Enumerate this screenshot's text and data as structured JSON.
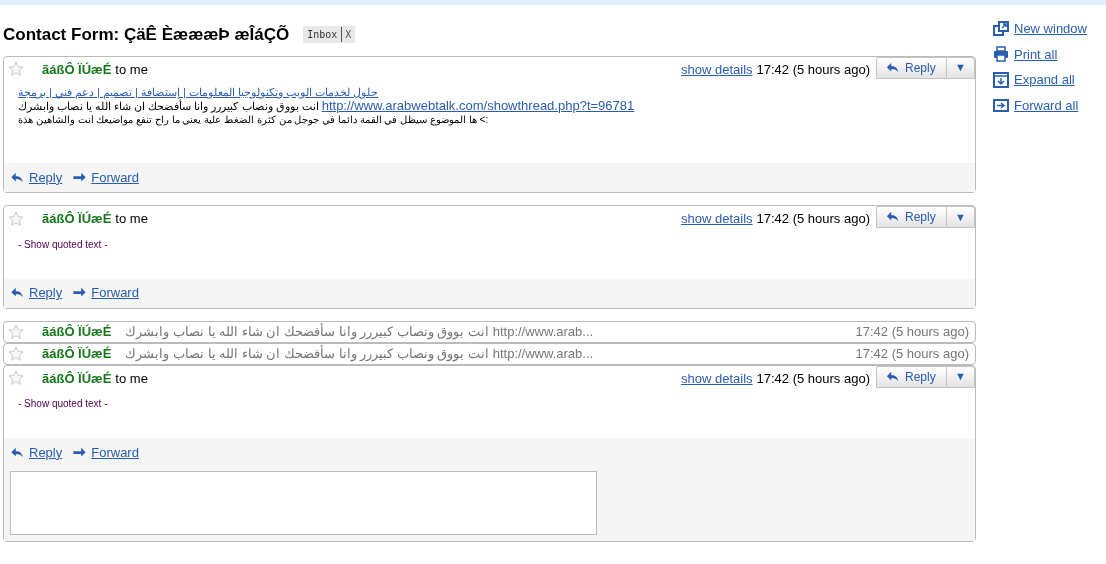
{
  "subject": "Contact Form: ÇäÊ ÈæææÞ æÎáÇÕ",
  "labels": [
    {
      "text": "Inbox",
      "remove": "X"
    }
  ],
  "messages": [
    {
      "kind": "expanded",
      "starred": false,
      "sender": "ãáßÔ ÏÚæÉ",
      "recipient": "to me",
      "details_link": "show details",
      "time": "17:42 (5 hours ago)",
      "reply_button": "Reply",
      "menu_button": "▼",
      "body": [
        {
          "kind": "link",
          "text": "حلول لخدمات الويب وتكنولوجيا المعلومات | إستضافة | تصميم | دعم فني | برمجة"
        },
        {
          "kind": "text_link",
          "text": "انت بووق ونصاب كبيررر وانا سأفضحك ان شاء الله يا نصاب وابشرك ",
          "link": "http://www.arabwebtalk.com/showthread.php?t=96781"
        },
        {
          "kind": "text",
          "text": "ها الموضوع سيظل في القمة دائما في جوجل من كثرة الضغط علية يعني ما راح تنفع مواضيعك انت والشاهين هذة <:"
        }
      ],
      "actions": [
        "Reply",
        "Forward"
      ]
    },
    {
      "kind": "expanded",
      "starred": false,
      "sender": "ãáßÔ ÏÚæÉ",
      "recipient": "to me",
      "details_link": "show details",
      "time": "17:42 (5 hours ago)",
      "reply_button": "Reply",
      "menu_button": "▼",
      "quoted": "- Show quoted text -",
      "actions": [
        "Reply",
        "Forward"
      ]
    },
    {
      "kind": "collapsed",
      "starred": false,
      "sender": "ãáßÔ ÏÚæÉ",
      "snippet": "انت بووق ونصاب كبيررر وانا سأفضحك ان شاء الله يا نصاب وابشرك http://www.arab...",
      "time": "17:42 (5 hours ago)"
    },
    {
      "kind": "collapsed",
      "starred": false,
      "sender": "ãáßÔ ÏÚæÉ",
      "snippet": "انت بووق ونصاب كبيررر وانا سأفضحك ان شاء الله يا نصاب وابشرك http://www.arab...",
      "time": "17:42 (5 hours ago)"
    },
    {
      "kind": "expanded",
      "starred": false,
      "sender": "ãáßÔ ÏÚæÉ",
      "recipient": "to me",
      "details_link": "show details",
      "time": "17:42 (5 hours ago)",
      "reply_button": "Reply",
      "menu_button": "▼",
      "quoted": "- Show quoted text -",
      "actions": [
        "Reply",
        "Forward"
      ],
      "composer": true
    }
  ],
  "side_actions": [
    {
      "kind": "new_window",
      "label": "New window"
    },
    {
      "kind": "print",
      "label": "Print all"
    },
    {
      "kind": "expand",
      "label": "Expand all"
    },
    {
      "kind": "forward",
      "label": "Forward all"
    }
  ]
}
